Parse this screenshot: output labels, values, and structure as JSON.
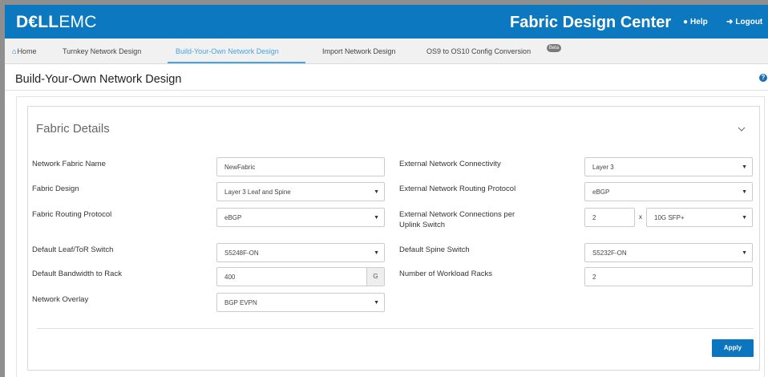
{
  "header": {
    "logo_primary": "D€LL",
    "logo_secondary": "EMC",
    "app_title": "Fabric Design Center",
    "help_label": "Help",
    "logout_label": "Logout",
    "brand_color": "#0b78c0"
  },
  "tabs": [
    {
      "label": "Home",
      "icon": "home-icon",
      "active": false
    },
    {
      "label": "Turnkey Network Design",
      "active": false
    },
    {
      "label": "Build-Your-Own Network Design",
      "active": true
    },
    {
      "label": "Import Network Design",
      "active": false
    },
    {
      "label": "OS9 to OS10 Config Conversion",
      "badge": "Beta",
      "active": false
    }
  ],
  "page": {
    "title": "Build-Your-Own Network Design"
  },
  "panel": {
    "title": "Fabric Details",
    "left_fields": [
      {
        "label": "Network Fabric Name",
        "value": "NewFabric",
        "type": "text"
      },
      {
        "label": "Fabric Design",
        "value": "Layer 3 Leaf and Spine",
        "type": "select"
      },
      {
        "label": "Fabric Routing Protocol",
        "value": "eBGP",
        "type": "select"
      },
      {
        "label": "Default Leaf/ToR Switch",
        "value": "S5248F-ON",
        "type": "select"
      },
      {
        "label": "Default Bandwidth to Rack",
        "value": "400",
        "unit": "G",
        "type": "text"
      },
      {
        "label": "Network Overlay",
        "value": "BGP EVPN",
        "type": "select"
      }
    ],
    "right_fields": [
      {
        "label": "External Network Connectivity",
        "value": "Layer 3",
        "type": "select"
      },
      {
        "label": "External Network Routing Protocol",
        "value": "eBGP",
        "type": "select"
      },
      {
        "label_line1": "External Network Connections per",
        "label_line2": "Uplink Switch",
        "count": "2",
        "separator": "x",
        "speed": "10G SFP+",
        "type": "compound"
      },
      {
        "label": "Default Spine Switch",
        "value": "S5232F-ON",
        "type": "select"
      },
      {
        "label": "Number of Workload Racks",
        "value": "2",
        "type": "text"
      }
    ],
    "apply_label": "Apply",
    "accent_color": "#0b75c0"
  }
}
